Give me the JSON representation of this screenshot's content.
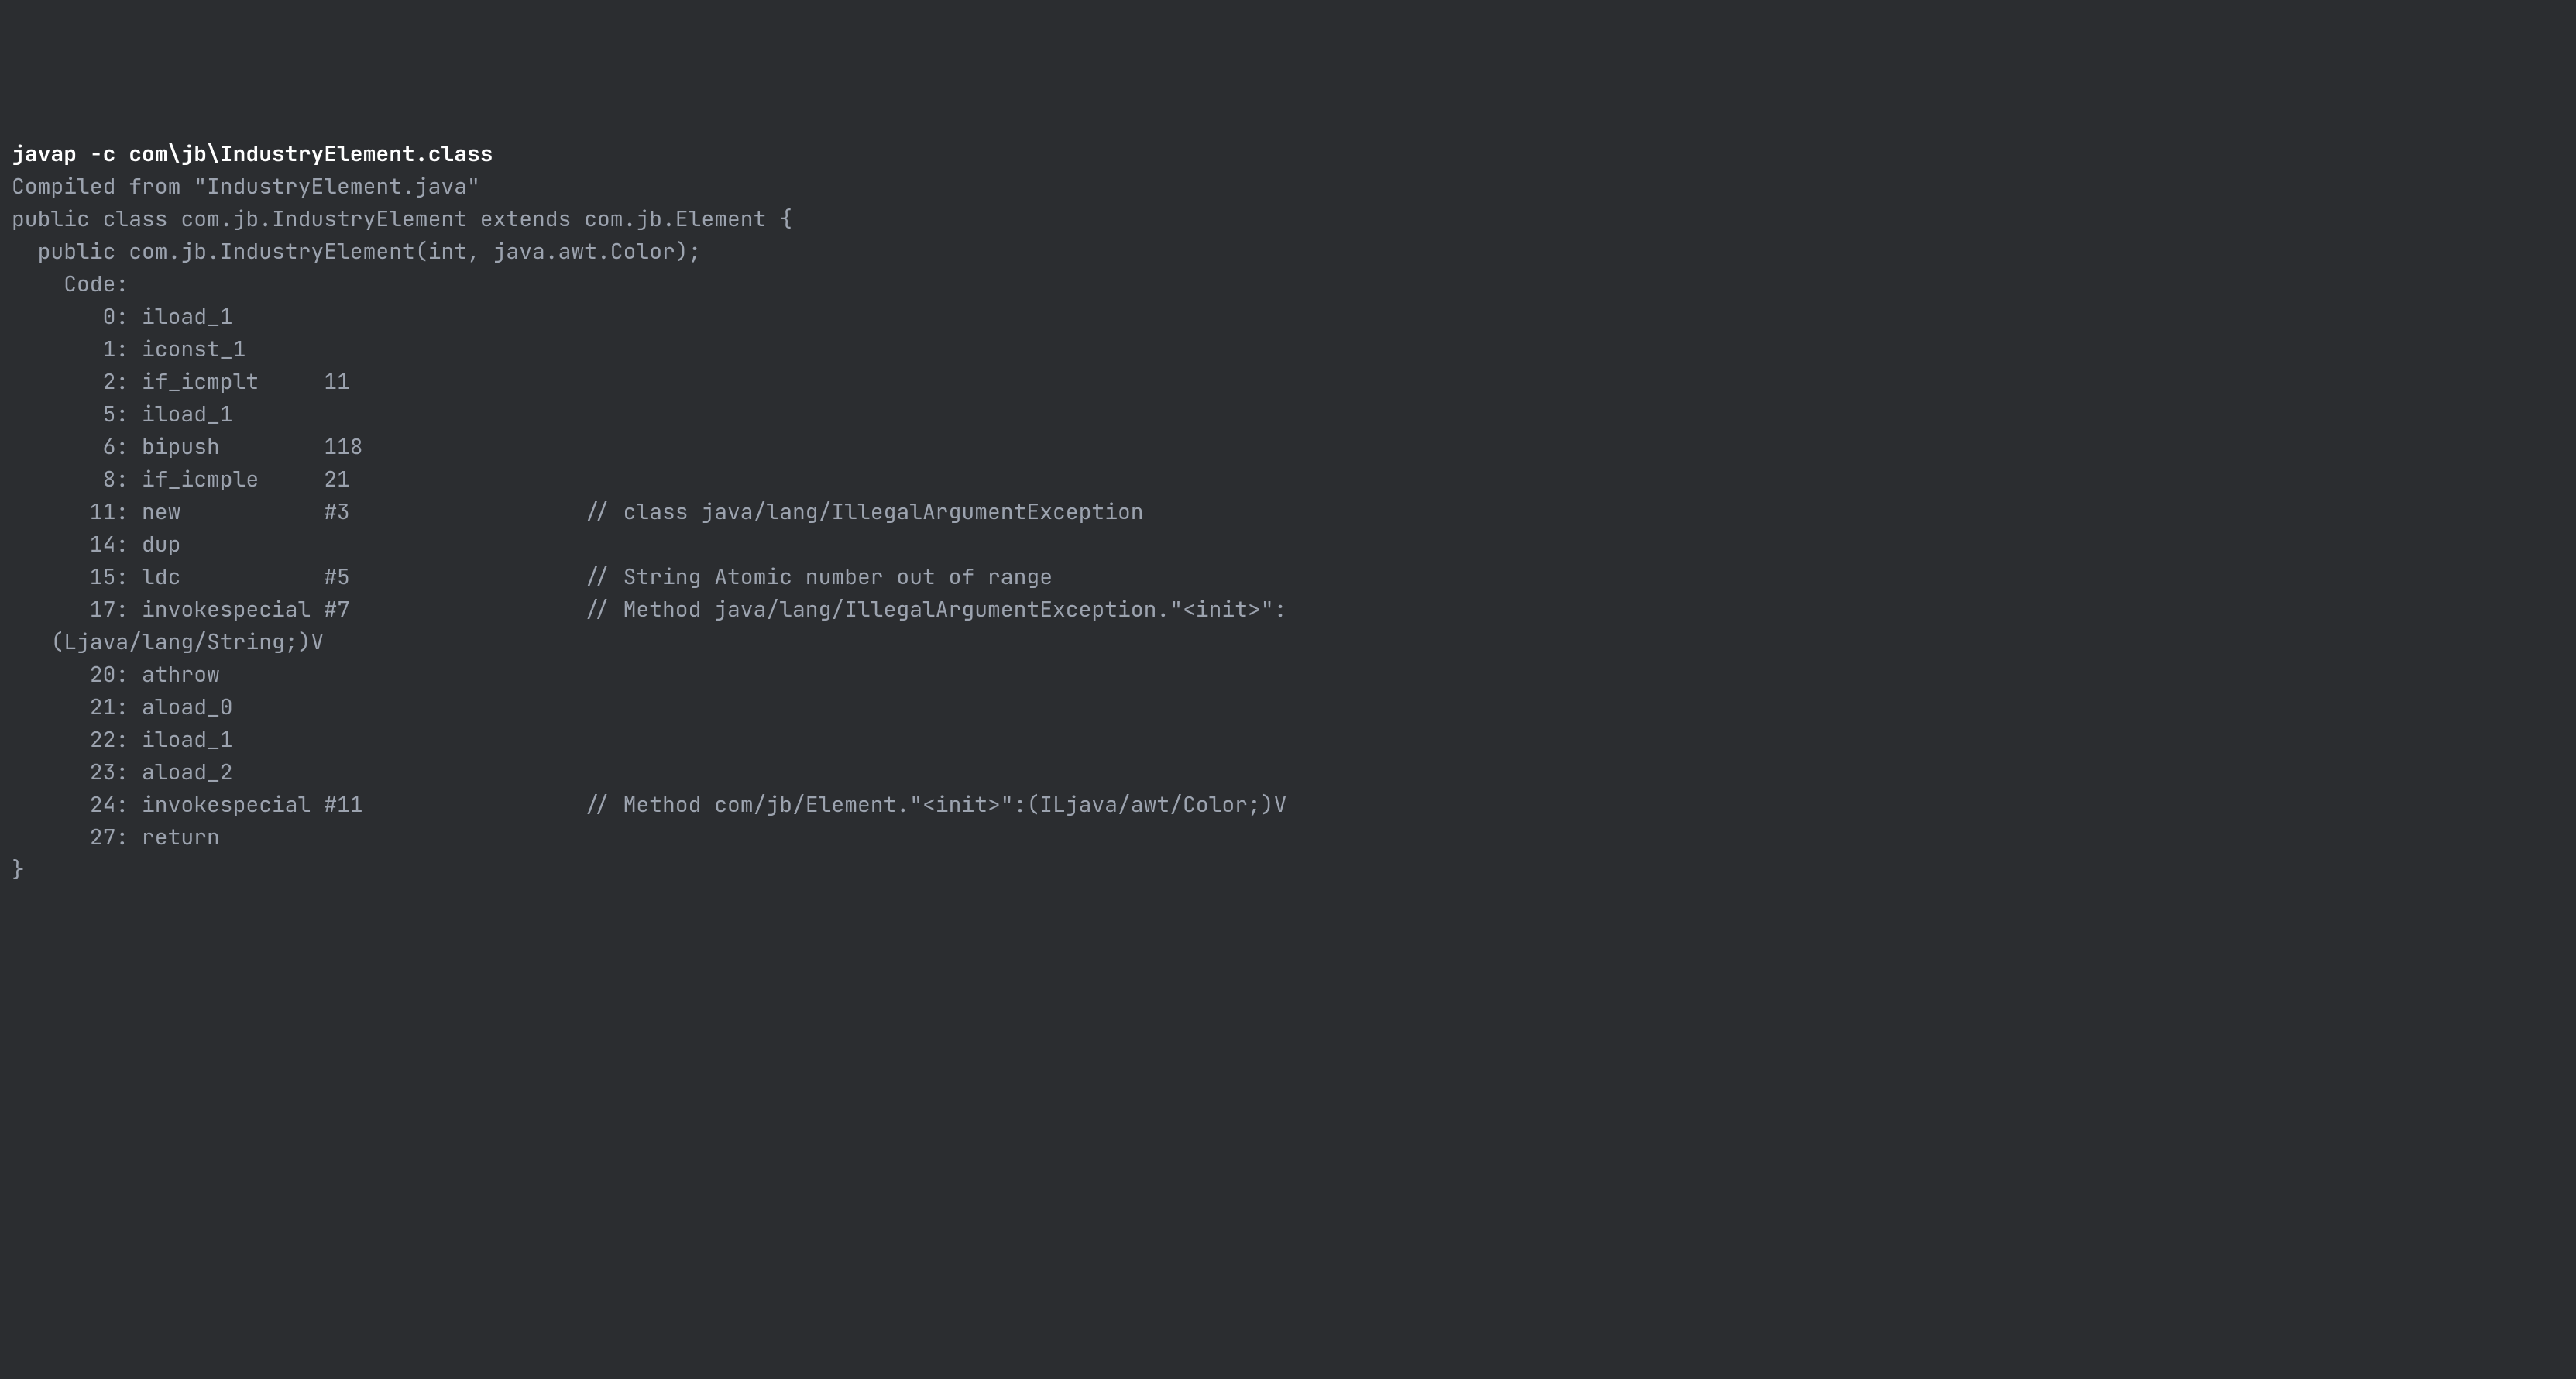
{
  "terminal": {
    "command": "javap -c com\\jb\\IndustryElement.class",
    "compiledFrom": "Compiled from \"IndustryElement.java\"",
    "classDecl": "public class com.jb.IndustryElement extends com.jb.Element {",
    "constructorDecl": "  public com.jb.IndustryElement(int, java.awt.Color);",
    "codeLabel": "    Code:",
    "instructions": [
      "       0: iload_1",
      "       1: iconst_1",
      "       2: if_icmplt     11",
      "       5: iload_1",
      "       6: bipush        118",
      "       8: if_icmple     21",
      "      11: new           #3                  // class java/lang/IllegalArgumentException",
      "      14: dup",
      "      15: ldc           #5                  // String Atomic number out of range",
      "      17: invokespecial #7                  // Method java/lang/IllegalArgumentException.\"<init>\":",
      "   (Ljava/lang/String;)V",
      "      20: athrow",
      "      21: aload_0",
      "      22: iload_1",
      "      23: aload_2",
      "      24: invokespecial #11                 // Method com/jb/Element.\"<init>\":(ILjava/awt/Color;)V",
      "      27: return"
    ],
    "closingBrace": "}"
  }
}
